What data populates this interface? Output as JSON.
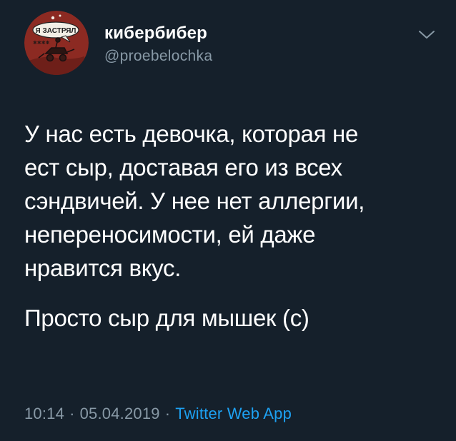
{
  "tweet": {
    "author": {
      "display_name": "кибербибер",
      "handle": "@proebelochka",
      "avatar": {
        "icon": "comic-avatar-icon",
        "speech_bubble_text": "Я ЗАСТРЯЛ",
        "background_color": "#8c2a22"
      }
    },
    "menu_icon": "chevron-down-icon",
    "paragraphs": [
      "У нас есть девочка, которая не\nест сыр, доставая его из всех\nсэндвичей. У нее нет аллергии,\nнепереносимости, ей даже\nнравится вкус.",
      "Просто сыр для мышек (с)"
    ],
    "time": "10:14",
    "date": "05.04.2019",
    "separator": "·",
    "source": "Twitter Web App"
  },
  "colors": {
    "background": "#15202b",
    "text_primary": "#ffffff",
    "text_secondary": "#8899a6",
    "link": "#1da1f2"
  }
}
